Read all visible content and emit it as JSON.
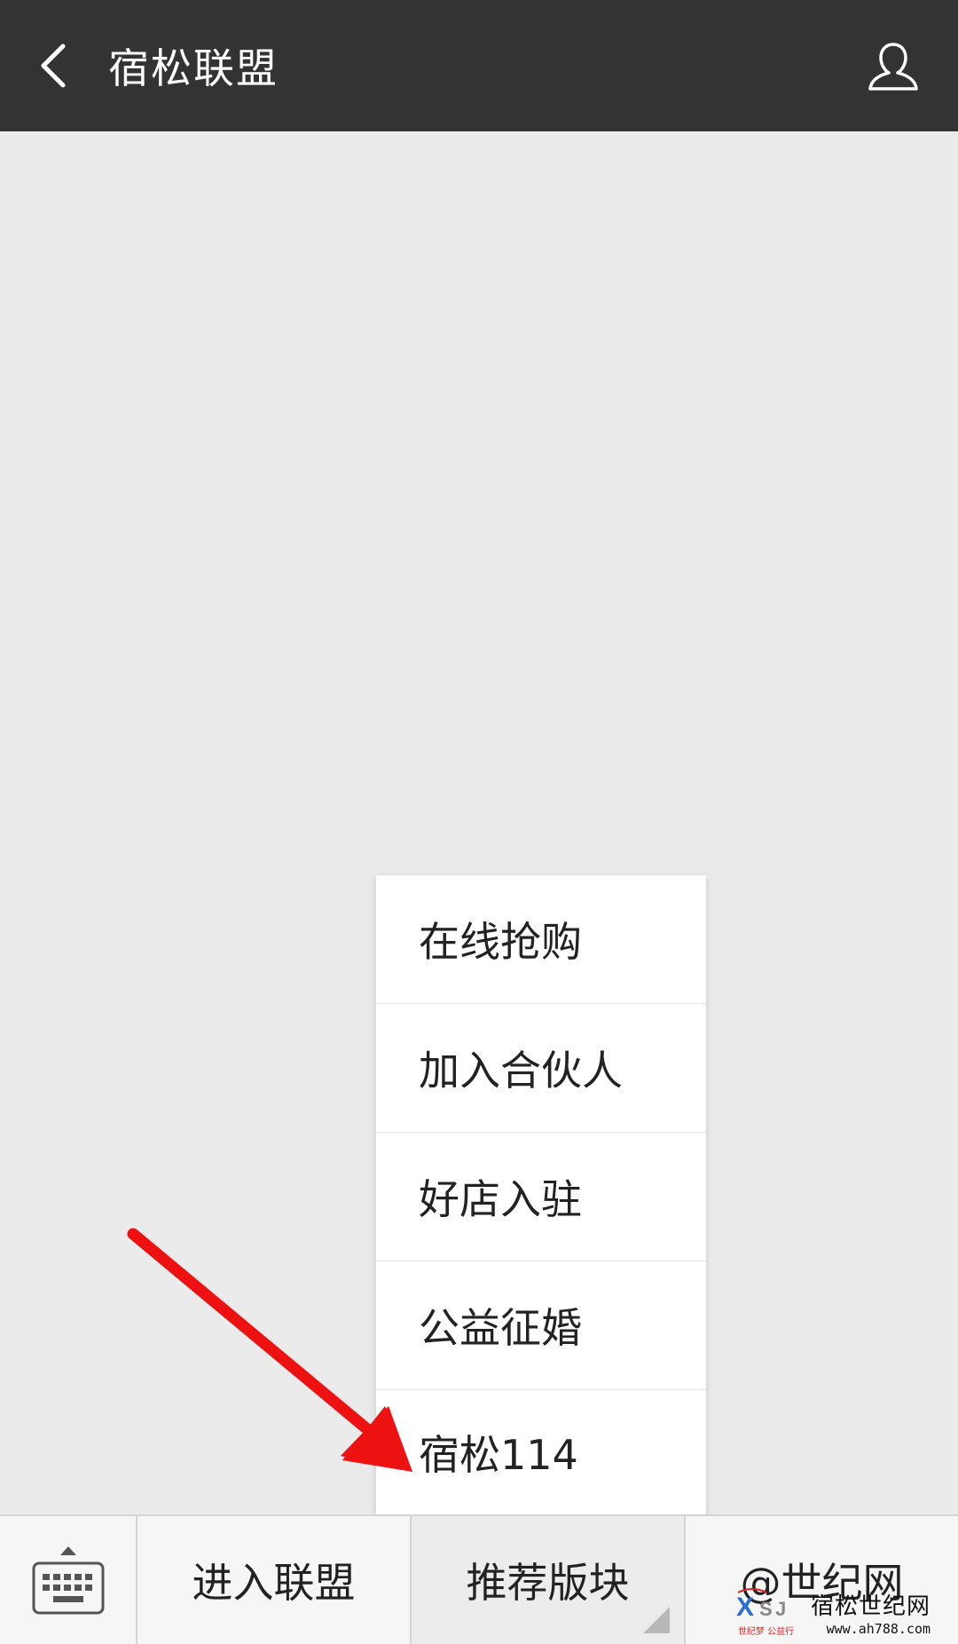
{
  "header": {
    "title": "宿松联盟",
    "back_icon": "chevron-left-icon",
    "profile_icon": "person-icon"
  },
  "popup_menu": {
    "items": [
      {
        "label": "在线抢购"
      },
      {
        "label": "加入合伙人"
      },
      {
        "label": "好店入驻"
      },
      {
        "label": "公益征婚"
      },
      {
        "label": "宿松114"
      }
    ]
  },
  "bottom_bar": {
    "keyboard_icon": "keyboard-icon",
    "tabs": [
      {
        "label": "进入联盟"
      },
      {
        "label": "推荐版块"
      },
      {
        "label": "@世纪网"
      }
    ]
  },
  "watermark": {
    "logo_letters": "XSJ",
    "logo_caption": "世纪梦 公益行",
    "name": "宿松世纪网",
    "url": "www.ah788.com"
  },
  "colors": {
    "header_bg": "#333336",
    "page_bg": "#ebebeb",
    "menu_bg": "#ffffff",
    "arrow": "#ee1111"
  }
}
